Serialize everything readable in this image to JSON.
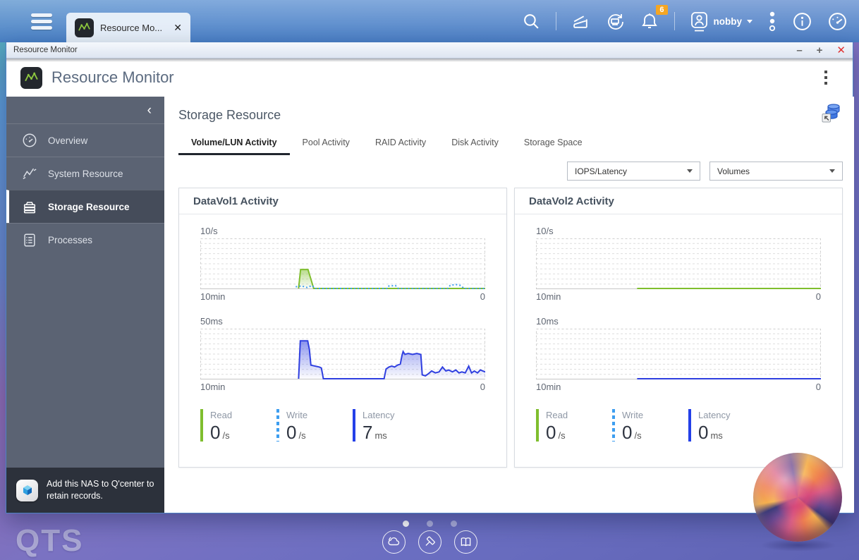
{
  "topbar": {
    "tab_label": "Resource Mo...",
    "tab_close_glyph": "✕",
    "notification_count": "6",
    "user_name": "nobby"
  },
  "window": {
    "title": "Resource Monitor",
    "controls": {
      "minimize": "–",
      "maximize": "+",
      "close": "✕"
    }
  },
  "app": {
    "title": "Resource Monitor",
    "page_title": "Storage Resource",
    "tabs": [
      {
        "label": "Volume/LUN Activity"
      },
      {
        "label": "Pool Activity"
      },
      {
        "label": "RAID Activity"
      },
      {
        "label": "Disk Activity"
      },
      {
        "label": "Storage Space"
      }
    ],
    "filters": [
      {
        "value": "IOPS/Latency"
      },
      {
        "value": "Volumes"
      }
    ]
  },
  "sidebar": {
    "items": [
      {
        "label": "Overview"
      },
      {
        "label": "System Resource"
      },
      {
        "label": "Storage Resource"
      },
      {
        "label": "Processes"
      }
    ],
    "notice": "Add this NAS to Q'center to retain records."
  },
  "cards": [
    {
      "title": "DataVol1 Activity",
      "stats": [
        {
          "label": "Read",
          "value": "0",
          "unit": "/s"
        },
        {
          "label": "Write",
          "value": "0",
          "unit": "/s"
        },
        {
          "label": "Latency",
          "value": "7",
          "unit": "ms"
        }
      ]
    },
    {
      "title": "DataVol2 Activity",
      "stats": [
        {
          "label": "Read",
          "value": "0",
          "unit": "/s"
        },
        {
          "label": "Write",
          "value": "0",
          "unit": "/s"
        },
        {
          "label": "Latency",
          "value": "0",
          "unit": "ms"
        }
      ]
    }
  ],
  "chart_data": [
    {
      "type": "area",
      "title": "DataVol1 IOPS",
      "ylabel": "10/s",
      "ymax": 10,
      "x_left_label": "10min",
      "x_right_label": "0",
      "grid": true,
      "legend_position": "none",
      "series": [
        {
          "name": "read",
          "color": "#7fbe2e",
          "style": "solid",
          "fill": true,
          "points": [
            [
              0.345,
              0
            ],
            [
              0.352,
              3.9
            ],
            [
              0.378,
              3.9
            ],
            [
              0.398,
              0
            ],
            [
              1,
              0
            ]
          ]
        },
        {
          "name": "write",
          "color": "#3d9ef0",
          "style": "dotted",
          "fill": false,
          "points": [
            [
              0.335,
              0.35
            ],
            [
              0.355,
              0.5
            ],
            [
              0.375,
              0.2
            ],
            [
              0.392,
              0.6
            ],
            [
              0.405,
              0
            ],
            [
              0.655,
              0
            ],
            [
              0.662,
              0.5
            ],
            [
              0.685,
              0.6
            ],
            [
              0.695,
              0
            ],
            [
              0.868,
              0
            ],
            [
              0.878,
              0.7
            ],
            [
              0.9,
              0.8
            ],
            [
              0.915,
              0.6
            ],
            [
              0.925,
              0
            ],
            [
              1,
              0
            ]
          ]
        }
      ]
    },
    {
      "type": "area",
      "title": "DataVol1 Latency",
      "ylabel": "50ms",
      "ymax": 50,
      "x_left_label": "10min",
      "x_right_label": "0",
      "grid": true,
      "legend_position": "none",
      "series": [
        {
          "name": "latency",
          "color": "#2f3fe0",
          "style": "solid",
          "fill": true,
          "points": [
            [
              0.345,
              0
            ],
            [
              0.351,
              39
            ],
            [
              0.377,
              39
            ],
            [
              0.383,
              30
            ],
            [
              0.388,
              14
            ],
            [
              0.418,
              12
            ],
            [
              0.425,
              11
            ],
            [
              0.432,
              0
            ],
            [
              0.645,
              0
            ],
            [
              0.652,
              10
            ],
            [
              0.662,
              12
            ],
            [
              0.672,
              13
            ],
            [
              0.682,
              12
            ],
            [
              0.692,
              14
            ],
            [
              0.702,
              15
            ],
            [
              0.708,
              24
            ],
            [
              0.712,
              28
            ],
            [
              0.718,
              25
            ],
            [
              0.73,
              26
            ],
            [
              0.745,
              25
            ],
            [
              0.76,
              26
            ],
            [
              0.774,
              25
            ],
            [
              0.779,
              4
            ],
            [
              0.79,
              3
            ],
            [
              0.8,
              5
            ],
            [
              0.812,
              8
            ],
            [
              0.825,
              6
            ],
            [
              0.838,
              7
            ],
            [
              0.85,
              12
            ],
            [
              0.862,
              8
            ],
            [
              0.872,
              9
            ],
            [
              0.885,
              7
            ],
            [
              0.897,
              9
            ],
            [
              0.908,
              6
            ],
            [
              0.918,
              7
            ],
            [
              0.93,
              6
            ],
            [
              0.942,
              13
            ],
            [
              0.952,
              6
            ],
            [
              0.962,
              8
            ],
            [
              0.973,
              6
            ],
            [
              0.983,
              9
            ],
            [
              1,
              7
            ]
          ]
        }
      ]
    },
    {
      "type": "line",
      "title": "DataVol2 IOPS",
      "ylabel": "10/s",
      "ymax": 10,
      "x_left_label": "10min",
      "x_right_label": "0",
      "grid": true,
      "legend_position": "none",
      "series": [
        {
          "name": "read",
          "color": "#7fbe2e",
          "style": "solid",
          "fill": false,
          "points": [
            [
              0.355,
              0
            ],
            [
              1,
              0
            ]
          ]
        }
      ]
    },
    {
      "type": "line",
      "title": "DataVol2 Latency",
      "ylabel": "10ms",
      "ymax": 10,
      "x_left_label": "10min",
      "x_right_label": "0",
      "grid": true,
      "legend_position": "none",
      "series": [
        {
          "name": "latency",
          "color": "#2f3fe0",
          "style": "solid",
          "fill": false,
          "points": [
            [
              0.355,
              0
            ],
            [
              1,
              0
            ]
          ]
        }
      ]
    }
  ],
  "desktop": {
    "logo_text": "QTS"
  }
}
